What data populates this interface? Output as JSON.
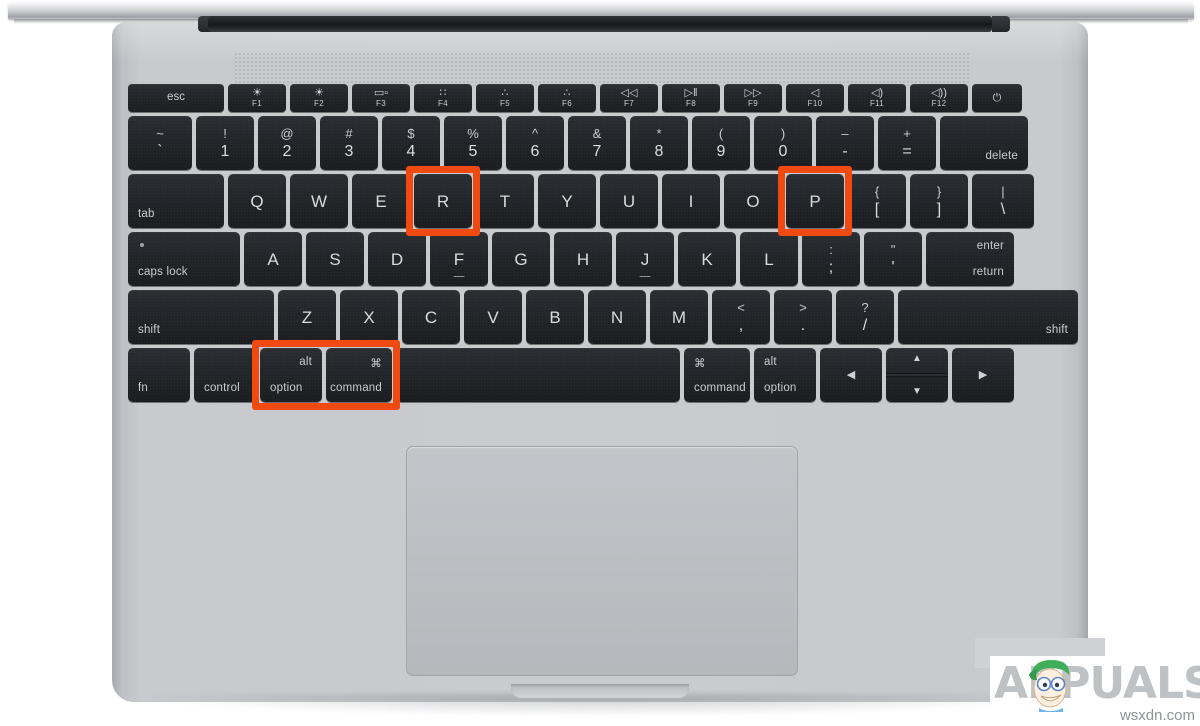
{
  "device": {
    "name": "MacBook",
    "color_chassis": "#c8cacd",
    "color_key": "#23262a",
    "color_highlight": "#f04a10"
  },
  "highlights": {
    "keys": [
      "R",
      "P",
      "option",
      "command"
    ],
    "shortcut": "Command + Option + P + R"
  },
  "keyboard": {
    "function_row": [
      {
        "name": "esc",
        "label": "esc",
        "icon": "",
        "fn": ""
      },
      {
        "name": "f1",
        "label": "",
        "icon": "brightness-down-icon",
        "glyph": "☀",
        "fn": "F1"
      },
      {
        "name": "f2",
        "label": "",
        "icon": "brightness-up-icon",
        "glyph": "☀",
        "fn": "F2"
      },
      {
        "name": "f3",
        "label": "",
        "icon": "mission-control-icon",
        "glyph": "▭▫",
        "fn": "F3"
      },
      {
        "name": "f4",
        "label": "",
        "icon": "launchpad-icon",
        "glyph": "∷",
        "fn": "F4"
      },
      {
        "name": "f5",
        "label": "",
        "icon": "keyboard-backlight-down-icon",
        "glyph": "∴",
        "fn": "F5"
      },
      {
        "name": "f6",
        "label": "",
        "icon": "keyboard-backlight-up-icon",
        "glyph": "∴",
        "fn": "F6"
      },
      {
        "name": "f7",
        "label": "",
        "icon": "rewind-icon",
        "glyph": "◁◁",
        "fn": "F7"
      },
      {
        "name": "f8",
        "label": "",
        "icon": "play-pause-icon",
        "glyph": "▷‖",
        "fn": "F8"
      },
      {
        "name": "f9",
        "label": "",
        "icon": "fast-forward-icon",
        "glyph": "▷▷",
        "fn": "F9"
      },
      {
        "name": "f10",
        "label": "",
        "icon": "mute-icon",
        "glyph": "◁",
        "fn": "F10"
      },
      {
        "name": "f11",
        "label": "",
        "icon": "volume-down-icon",
        "glyph": "◁)",
        "fn": "F11"
      },
      {
        "name": "f12",
        "label": "",
        "icon": "volume-up-icon",
        "glyph": "◁))",
        "fn": "F12"
      },
      {
        "name": "power",
        "label": "",
        "icon": "power-icon",
        "glyph": "⏻",
        "fn": ""
      }
    ],
    "number_row": [
      {
        "name": "backtick",
        "top": "~",
        "bottom": "`"
      },
      {
        "name": "1",
        "top": "!",
        "bottom": "1"
      },
      {
        "name": "2",
        "top": "@",
        "bottom": "2"
      },
      {
        "name": "3",
        "top": "#",
        "bottom": "3"
      },
      {
        "name": "4",
        "top": "$",
        "bottom": "4"
      },
      {
        "name": "5",
        "top": "%",
        "bottom": "5"
      },
      {
        "name": "6",
        "top": "^",
        "bottom": "6"
      },
      {
        "name": "7",
        "top": "&",
        "bottom": "7"
      },
      {
        "name": "8",
        "top": "*",
        "bottom": "8"
      },
      {
        "name": "9",
        "top": "(",
        "bottom": "9"
      },
      {
        "name": "0",
        "top": ")",
        "bottom": "0"
      },
      {
        "name": "minus",
        "top": "–",
        "bottom": "-"
      },
      {
        "name": "equals",
        "top": "+",
        "bottom": "="
      },
      {
        "name": "delete",
        "label": "delete"
      }
    ],
    "top_row": [
      {
        "name": "tab",
        "label": "tab"
      },
      {
        "name": "Q",
        "label": "Q"
      },
      {
        "name": "W",
        "label": "W"
      },
      {
        "name": "E",
        "label": "E"
      },
      {
        "name": "R",
        "label": "R",
        "highlighted": true
      },
      {
        "name": "T",
        "label": "T"
      },
      {
        "name": "Y",
        "label": "Y"
      },
      {
        "name": "U",
        "label": "U"
      },
      {
        "name": "I",
        "label": "I"
      },
      {
        "name": "O",
        "label": "O"
      },
      {
        "name": "P",
        "label": "P",
        "highlighted": true
      },
      {
        "name": "bracket-left",
        "top": "{",
        "bottom": "["
      },
      {
        "name": "bracket-right",
        "top": "}",
        "bottom": "]"
      },
      {
        "name": "backslash",
        "top": "|",
        "bottom": "\\"
      }
    ],
    "home_row": [
      {
        "name": "caps-lock",
        "label": "caps lock"
      },
      {
        "name": "A",
        "label": "A"
      },
      {
        "name": "S",
        "label": "S"
      },
      {
        "name": "D",
        "label": "D"
      },
      {
        "name": "F",
        "label": "F"
      },
      {
        "name": "G",
        "label": "G"
      },
      {
        "name": "H",
        "label": "H"
      },
      {
        "name": "J",
        "label": "J"
      },
      {
        "name": "K",
        "label": "K"
      },
      {
        "name": "L",
        "label": "L"
      },
      {
        "name": "semicolon",
        "top": ":",
        "bottom": ";"
      },
      {
        "name": "quote",
        "top": "\"",
        "bottom": "'"
      },
      {
        "name": "return",
        "label_top": "enter",
        "label_bottom": "return"
      }
    ],
    "bottom_alpha_row": [
      {
        "name": "shift-left",
        "label": "shift"
      },
      {
        "name": "Z",
        "label": "Z"
      },
      {
        "name": "X",
        "label": "X"
      },
      {
        "name": "C",
        "label": "C"
      },
      {
        "name": "V",
        "label": "V"
      },
      {
        "name": "B",
        "label": "B"
      },
      {
        "name": "N",
        "label": "N"
      },
      {
        "name": "M",
        "label": "M"
      },
      {
        "name": "comma",
        "top": "<",
        "bottom": ","
      },
      {
        "name": "period",
        "top": ">",
        "bottom": "."
      },
      {
        "name": "slash",
        "top": "?",
        "bottom": "/"
      },
      {
        "name": "shift-right",
        "label": "shift"
      }
    ],
    "modifier_row": [
      {
        "name": "fn",
        "label": "fn"
      },
      {
        "name": "control",
        "label": "control"
      },
      {
        "name": "option-left",
        "label": "option",
        "alt_label": "alt",
        "highlighted": true
      },
      {
        "name": "command-left",
        "label": "command",
        "symbol": "⌘",
        "highlighted": true
      },
      {
        "name": "space",
        "label": ""
      },
      {
        "name": "command-right",
        "label": "command",
        "symbol": "⌘"
      },
      {
        "name": "option-right",
        "label": "option",
        "alt_label": "alt"
      },
      {
        "name": "arrow-left",
        "glyph": "◀"
      },
      {
        "name": "arrow-up-down",
        "up": "▲",
        "down": "▼"
      },
      {
        "name": "arrow-right",
        "glyph": "▶"
      }
    ]
  },
  "watermark": {
    "brand": "APPUALS",
    "site": "wsxdn.com"
  }
}
